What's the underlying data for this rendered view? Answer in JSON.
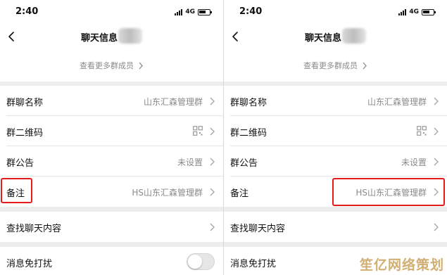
{
  "screens": [
    {
      "status": {
        "time": "2:40",
        "network": "4G"
      },
      "nav": {
        "title": "聊天信息"
      },
      "members": {
        "label": "查看更多群成员"
      },
      "group_settings": {
        "name": {
          "label": "群聊名称",
          "value": "山东汇森管理群"
        },
        "qrcode": {
          "label": "群二维码"
        },
        "notice": {
          "label": "群公告",
          "value": "未设置"
        },
        "remark": {
          "label": "备注",
          "value": "HS山东汇森管理群"
        }
      },
      "search": {
        "label": "查找聊天内容"
      },
      "mute": {
        "label": "消息免打扰",
        "enabled": false
      }
    },
    {
      "status": {
        "time": "2:40",
        "network": "4G"
      },
      "nav": {
        "title": "聊天信息"
      },
      "members": {
        "label": "查看更多群成员"
      },
      "group_settings": {
        "name": {
          "label": "群聊名称",
          "value": "山东汇森管理群"
        },
        "qrcode": {
          "label": "群二维码"
        },
        "notice": {
          "label": "群公告",
          "value": "未设置"
        },
        "remark": {
          "label": "备注",
          "value": "HS山东汇森管理群"
        }
      },
      "search": {
        "label": "查找聊天内容"
      },
      "mute": {
        "label": "消息免打扰",
        "enabled": false
      }
    }
  ],
  "watermark": "笙亿网络策划",
  "colors": {
    "highlight": "#e51b1b",
    "background": "#ededed",
    "secondary_text": "#8a8a8a"
  },
  "icons": [
    "back-arrow-icon",
    "chevron-right-icon",
    "qrcode-icon",
    "signal-icon",
    "battery-icon"
  ]
}
